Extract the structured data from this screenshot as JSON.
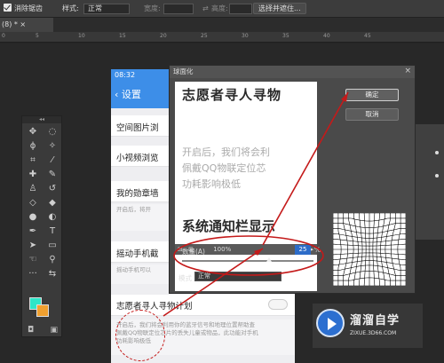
{
  "optbar": {
    "antialias_label": "消除锯齿",
    "style_label": "样式:",
    "style_value": "正常",
    "width_label": "宽度:",
    "height_label": "高度:",
    "select_mask_btn": "选择并遮住..."
  },
  "doc_tab": "(8) * ×",
  "ruler_ticks": [
    "0",
    "5",
    "10",
    "15",
    "20",
    "25",
    "30",
    "35",
    "40",
    "45"
  ],
  "tools_panel": {
    "header": "◂◂",
    "tools": [
      "move-icon",
      "marquee-icon",
      "lasso-icon",
      "magic-wand-icon",
      "crop-icon",
      "eyedropper-icon",
      "healing-icon",
      "brush-icon",
      "stamp-icon",
      "history-brush-icon",
      "eraser-icon",
      "bucket-icon",
      "blur-icon",
      "dodge-icon",
      "pen-icon",
      "type-icon",
      "path-select-icon",
      "shape-icon",
      "hand-icon",
      "zoom-icon"
    ],
    "fg_color": "#2ee6c8",
    "bg_color": "#f0a030"
  },
  "phone": {
    "time": "08:32",
    "back_label": "‹ 设置",
    "items": [
      {
        "title": "空间图片浏"
      },
      {
        "title": "小视频浏览"
      },
      {
        "title": "我的勋章墙"
      },
      {
        "title": "摇动手机截"
      },
      {
        "title": "志愿者寻人寻物计划"
      }
    ],
    "desc_1": "开启后，将开",
    "desc_2": "摇动手机可以",
    "desc_3_line1": "开启后，我们将会利用你的蓝牙信号和地理位置帮助查",
    "desc_3_line2": "佩戴QQ物联定位芯片的丢失儿童或物品，此功能对手机",
    "desc_3_line3": "功耗影响极低"
  },
  "dialog": {
    "title": "球面化",
    "close": "×",
    "ok_label": "确定",
    "cancel_label": "取消",
    "zoom_value": "100%",
    "amount_label": "数量(A)",
    "amount_value": "25",
    "mode_label": "模式",
    "mode_value": "正常",
    "preview_heading": "志愿者寻人寻物",
    "preview_body_1": "开启后，我们将会利",
    "preview_body_2": "佩戴QQ物联定位芯",
    "preview_body_3": "功耗影响极低",
    "preview_heading_2": "系统通知栏显示"
  },
  "watermark": {
    "name": "溜溜自学",
    "url": "ZIXUE.3D66.COM"
  },
  "annotation_color": "#c41a1a"
}
